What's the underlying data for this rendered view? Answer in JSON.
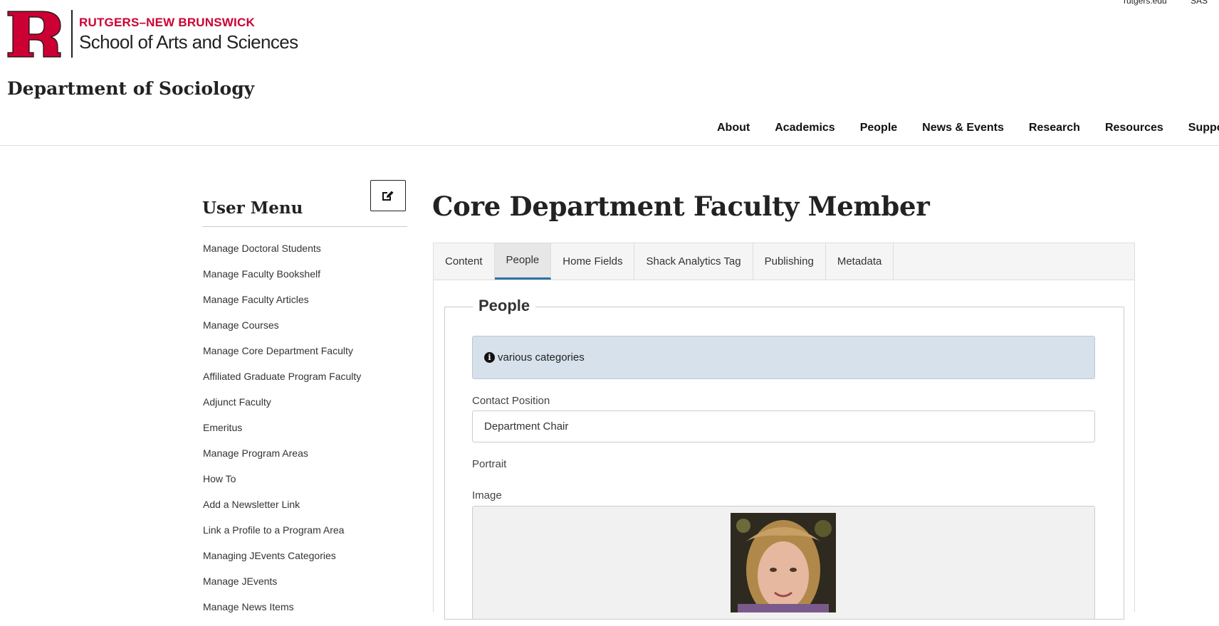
{
  "top_links": [
    "rutgers.edu",
    "SAS"
  ],
  "brand": {
    "line1": "RUTGERS–NEW BRUNSWICK",
    "line2": "School of Arts and Sciences",
    "department": "Department of Sociology",
    "accent_color": "#cc0033"
  },
  "nav": [
    "About",
    "Academics",
    "People",
    "News & Events",
    "Research",
    "Resources",
    "Suppo"
  ],
  "sidebar": {
    "title": "User Menu",
    "edit_icon": "edit-icon",
    "items": [
      "Manage Doctoral Students",
      "Manage Faculty Bookshelf",
      "Manage Faculty Articles",
      "Manage Courses",
      "Manage Core Department Faculty",
      "Affiliated Graduate Program Faculty",
      "Adjunct Faculty",
      "Emeritus",
      "Manage Program Areas",
      "How To",
      "Add a Newsletter Link",
      "Link a Profile to a Program Area",
      "Managing JEvents Categories",
      "Manage JEvents",
      "Manage News Items"
    ]
  },
  "main": {
    "title": "Core Department Faculty Member",
    "tabs": [
      "Content",
      "People",
      "Home Fields",
      "Shack Analytics Tag",
      "Publishing",
      "Metadata"
    ],
    "active_tab": "People",
    "fieldset_legend": "People",
    "alert_text": "various categories",
    "contact_position_label": "Contact Position",
    "contact_position_value": "Department Chair",
    "portrait_label": "Portrait",
    "image_label": "Image"
  }
}
